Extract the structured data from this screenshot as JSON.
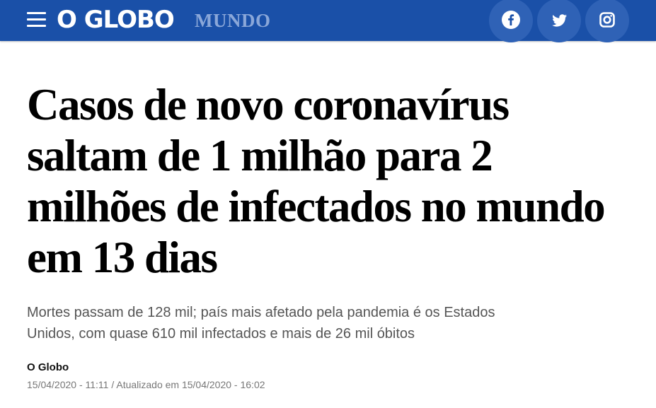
{
  "header": {
    "logo_text": "O GLOBO",
    "section_label": "MUNDO",
    "menu_icon": "hamburger-menu-icon",
    "social": [
      {
        "name": "facebook",
        "icon": "facebook-icon"
      },
      {
        "name": "twitter",
        "icon": "twitter-icon"
      },
      {
        "name": "instagram",
        "icon": "instagram-icon"
      }
    ],
    "colors": {
      "bar": "#1a50a8",
      "section": "#8aa7d9",
      "social_circle": "#2f62b6"
    }
  },
  "article": {
    "headline_lines": [
      "Casos de novo coronavírus",
      "saltam de 1 milhão para 2",
      "milhões de infectados no mundo",
      "em 13 dias"
    ],
    "subtitle_lines": [
      "Mortes passam de 128 mil; país mais afetado pela pandemia é os Estados",
      "Unidos, com quase 610 mil infectados e mais de 26 mil óbitos"
    ],
    "author": "O Globo",
    "dates": "15/04/2020 - 11:11 / Atualizado em 15/04/2020 - 16:02"
  }
}
